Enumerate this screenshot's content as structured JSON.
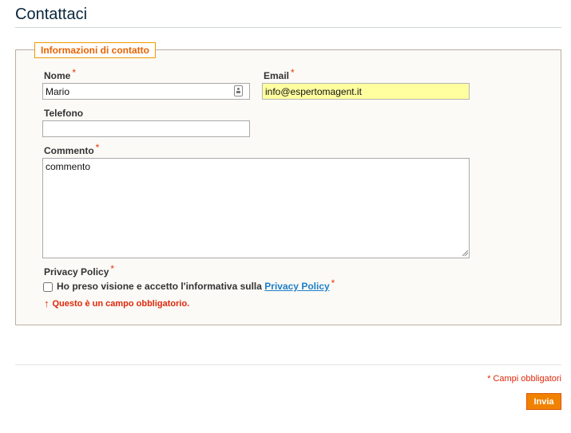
{
  "page": {
    "title": "Contattaci"
  },
  "form": {
    "legend": "Informazioni di contatto",
    "required_marker": "*",
    "fields": {
      "name": {
        "label": "Nome",
        "value": "Mario"
      },
      "email": {
        "label": "Email",
        "value": "info@espertomagent.it"
      },
      "phone": {
        "label": "Telefono",
        "value": ""
      },
      "comment": {
        "label": "Commento",
        "value": "commento"
      }
    },
    "privacy": {
      "label": "Privacy Policy",
      "checkbox_text": "Ho preso visione e accetto l'informativa sulla ",
      "link_text": "Privacy Policy",
      "error": "Questo è un campo obbligatorio.",
      "error_icon": "↑"
    }
  },
  "footer": {
    "required_note": "* Campi obbligatori",
    "submit_label": "Invia"
  },
  "colors": {
    "accent": "#f18200",
    "legend_text": "#e76200",
    "error": "#df280a",
    "link": "#1e7ec8",
    "autofill": "#ffffa0"
  },
  "icons": {
    "name_field": "contact-card-icon",
    "error": "up-arrow-icon",
    "textarea_resize": "resize-grip-icon"
  }
}
